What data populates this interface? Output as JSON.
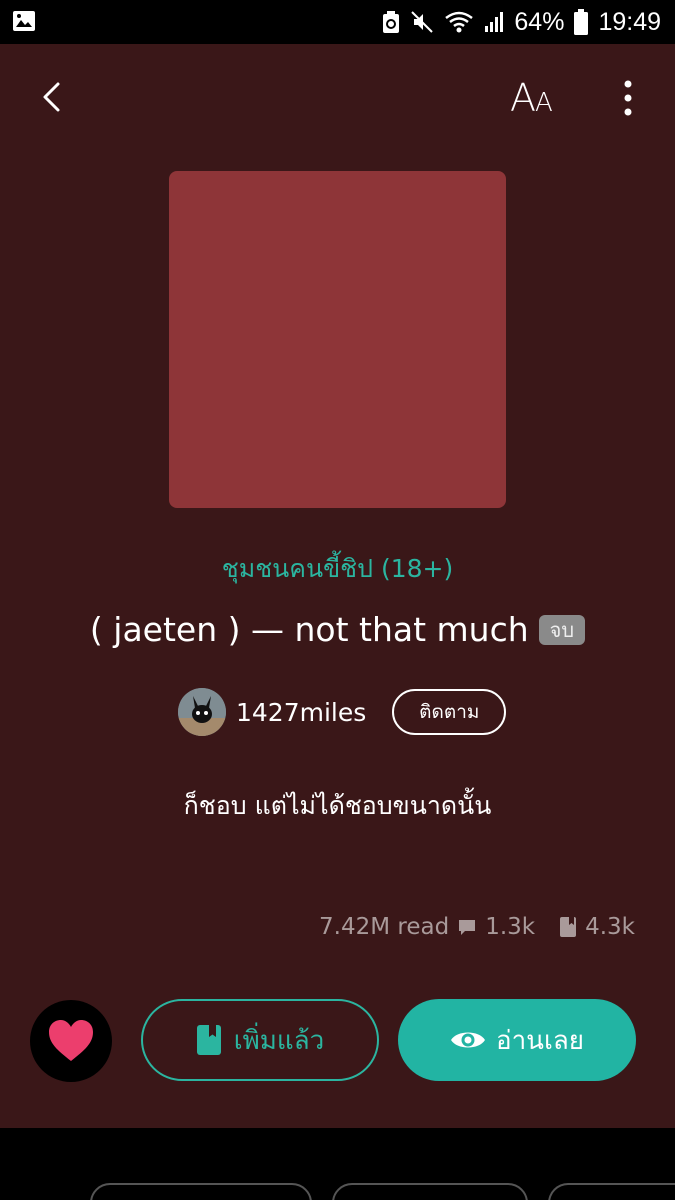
{
  "status_bar": {
    "battery_percent": "64%",
    "time": "19:49",
    "icons": [
      "gallery-icon",
      "recycle-icon",
      "mute-icon",
      "wifi-icon",
      "signal-icon",
      "battery-icon"
    ]
  },
  "header": {
    "font_size_label_big": "A",
    "font_size_label_small": "A",
    "icons": [
      "back-icon",
      "more-vert-icon"
    ]
  },
  "story": {
    "category": "ชุมชนคนขี้ชิป  (18+)",
    "title": "( jaeten ) — not that much",
    "status_badge": "จบ",
    "author": "1427miles",
    "follow_label": "ติดตาม",
    "description": "ก็ชอบ แต่ไม่ได้ชอบขนาดนั้น",
    "cover_color": "#8e3538"
  },
  "stats": {
    "reads": "7.42M read",
    "comments": "1.3k",
    "bookmarks": "4.3k"
  },
  "actions": {
    "added_label": "เพิ่มแล้ว",
    "read_label": "อ่านเลย"
  },
  "colors": {
    "background": "#3a1718",
    "accent": "#22b4a3",
    "heart": "#ec3e6d"
  }
}
